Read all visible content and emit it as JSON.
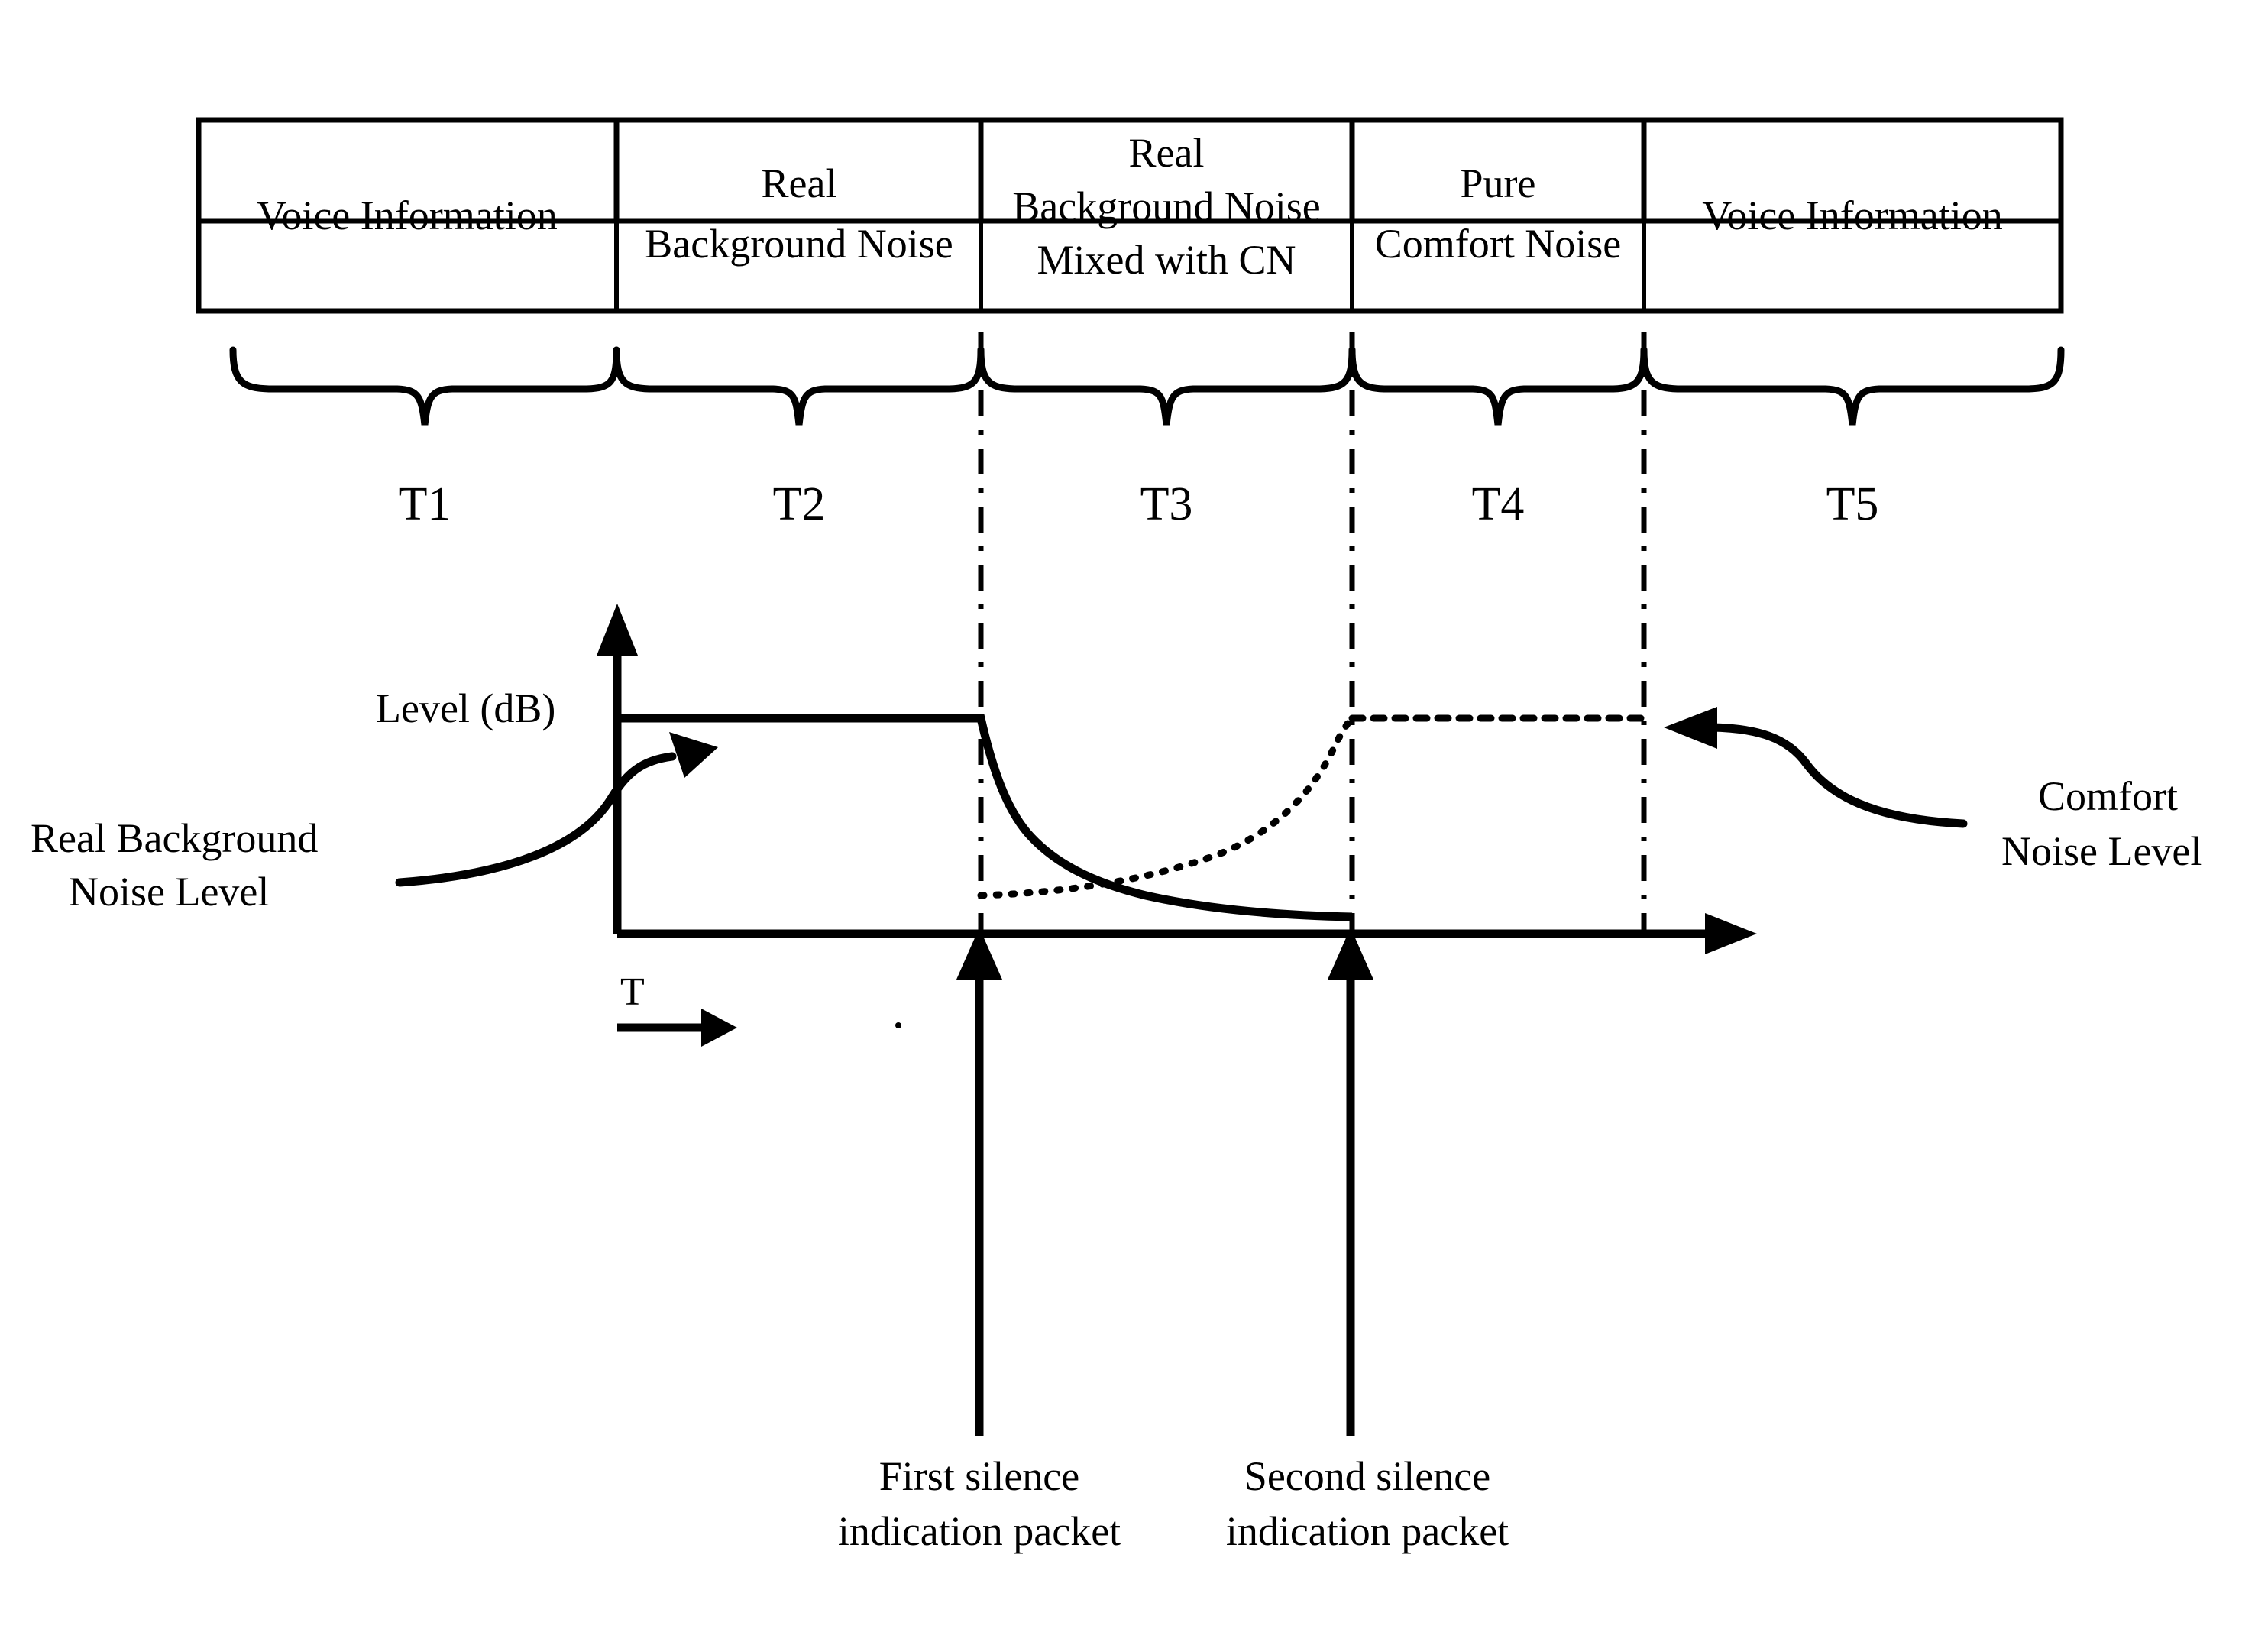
{
  "diagram": {
    "title_cells": [
      {
        "id": "t1",
        "lines": [
          "Voice Information"
        ]
      },
      {
        "id": "t2",
        "lines": [
          "Real",
          "Background Noise"
        ]
      },
      {
        "id": "t3",
        "lines": [
          "Real",
          "Background Noise",
          "Mixed with CN"
        ]
      },
      {
        "id": "t4",
        "lines": [
          "Pure",
          "Comfort Noise"
        ]
      },
      {
        "id": "t5",
        "lines": [
          "Voice Information"
        ]
      }
    ],
    "period_labels": [
      "T1",
      "T2",
      "T3",
      "T4",
      "T5"
    ],
    "axis": {
      "y_label": "Level (dB)",
      "x_label": "T"
    },
    "callouts": {
      "left": {
        "lines": [
          "Real Background",
          "Noise Level"
        ]
      },
      "right": {
        "lines": [
          "Comfort",
          "Noise Level"
        ]
      }
    },
    "captions": [
      {
        "lines": [
          "First silence",
          "indication packet"
        ]
      },
      {
        "lines": [
          "Second silence",
          "indication packet"
        ]
      }
    ],
    "colors": {
      "ink": "#000000",
      "background": "#ffffff"
    }
  },
  "chart_data": {
    "type": "line",
    "title": "",
    "xlabel": "T",
    "ylabel": "Level (dB)",
    "categories": [
      "T1",
      "T2",
      "T3",
      "T4",
      "T5"
    ],
    "x_boundaries": [
      260,
      807,
      1284,
      1770,
      2152,
      2698
    ],
    "levels": {
      "real_background_noise_level": 1.0,
      "comfort_noise_level": 1.0,
      "decayed_floor": 0.18
    },
    "grid": false,
    "legend": null,
    "series": [
      {
        "name": "Real Background Noise Level",
        "style": "solid",
        "points": [
          {
            "x": 807,
            "y": 1.0
          },
          {
            "x": 1284,
            "y": 1.0
          },
          {
            "x": 1330,
            "y": 0.72
          },
          {
            "x": 1420,
            "y": 0.5
          },
          {
            "x": 1560,
            "y": 0.31
          },
          {
            "x": 1700,
            "y": 0.22
          },
          {
            "x": 1770,
            "y": 0.18
          }
        ]
      },
      {
        "name": "Comfort Noise Level",
        "style": "dotted",
        "points": [
          {
            "x": 1284,
            "y": 0.07
          },
          {
            "x": 1450,
            "y": 0.12
          },
          {
            "x": 1600,
            "y": 0.22
          },
          {
            "x": 1700,
            "y": 0.45
          },
          {
            "x": 1755,
            "y": 0.8
          },
          {
            "x": 1770,
            "y": 1.0
          },
          {
            "x": 2152,
            "y": 1.0
          }
        ]
      }
    ],
    "markers": [
      {
        "label": "First silence indication packet",
        "x": 1284
      },
      {
        "label": "Second silence indication packet",
        "x": 1770
      }
    ]
  }
}
